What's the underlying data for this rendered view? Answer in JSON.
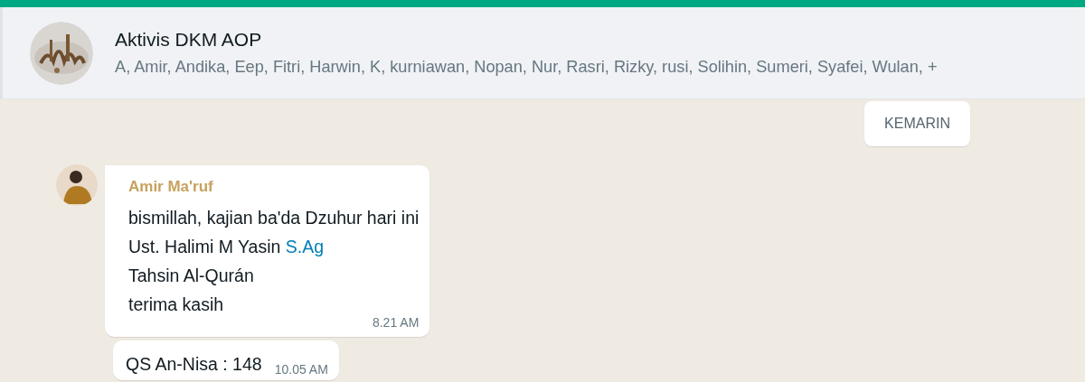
{
  "header": {
    "title": "Aktivis DKM AOP",
    "members": "A, Amir, Andika, Eep, Fitri, Harwin, K, kurniawan, Nopan, Nur, Rasri, Rizky, rusi, Solihin, Sumeri, Syafei, Wulan, +"
  },
  "date_divider": "KEMARIN",
  "messages": [
    {
      "sender": "Amir Ma'ruf",
      "lines": [
        {
          "text": "bismillah, kajian ba'da Dzuhur hari ini"
        },
        {
          "text": "Ust. Halimi M Yasin ",
          "link": "S.Ag"
        },
        {
          "text": "Tahsin Al-Qurán"
        },
        {
          "text": "terima kasih"
        }
      ],
      "time": "8.21 AM"
    },
    {
      "lines": [
        {
          "text": "QS An-Nisa : 148"
        }
      ],
      "time": "10.05 AM"
    }
  ]
}
